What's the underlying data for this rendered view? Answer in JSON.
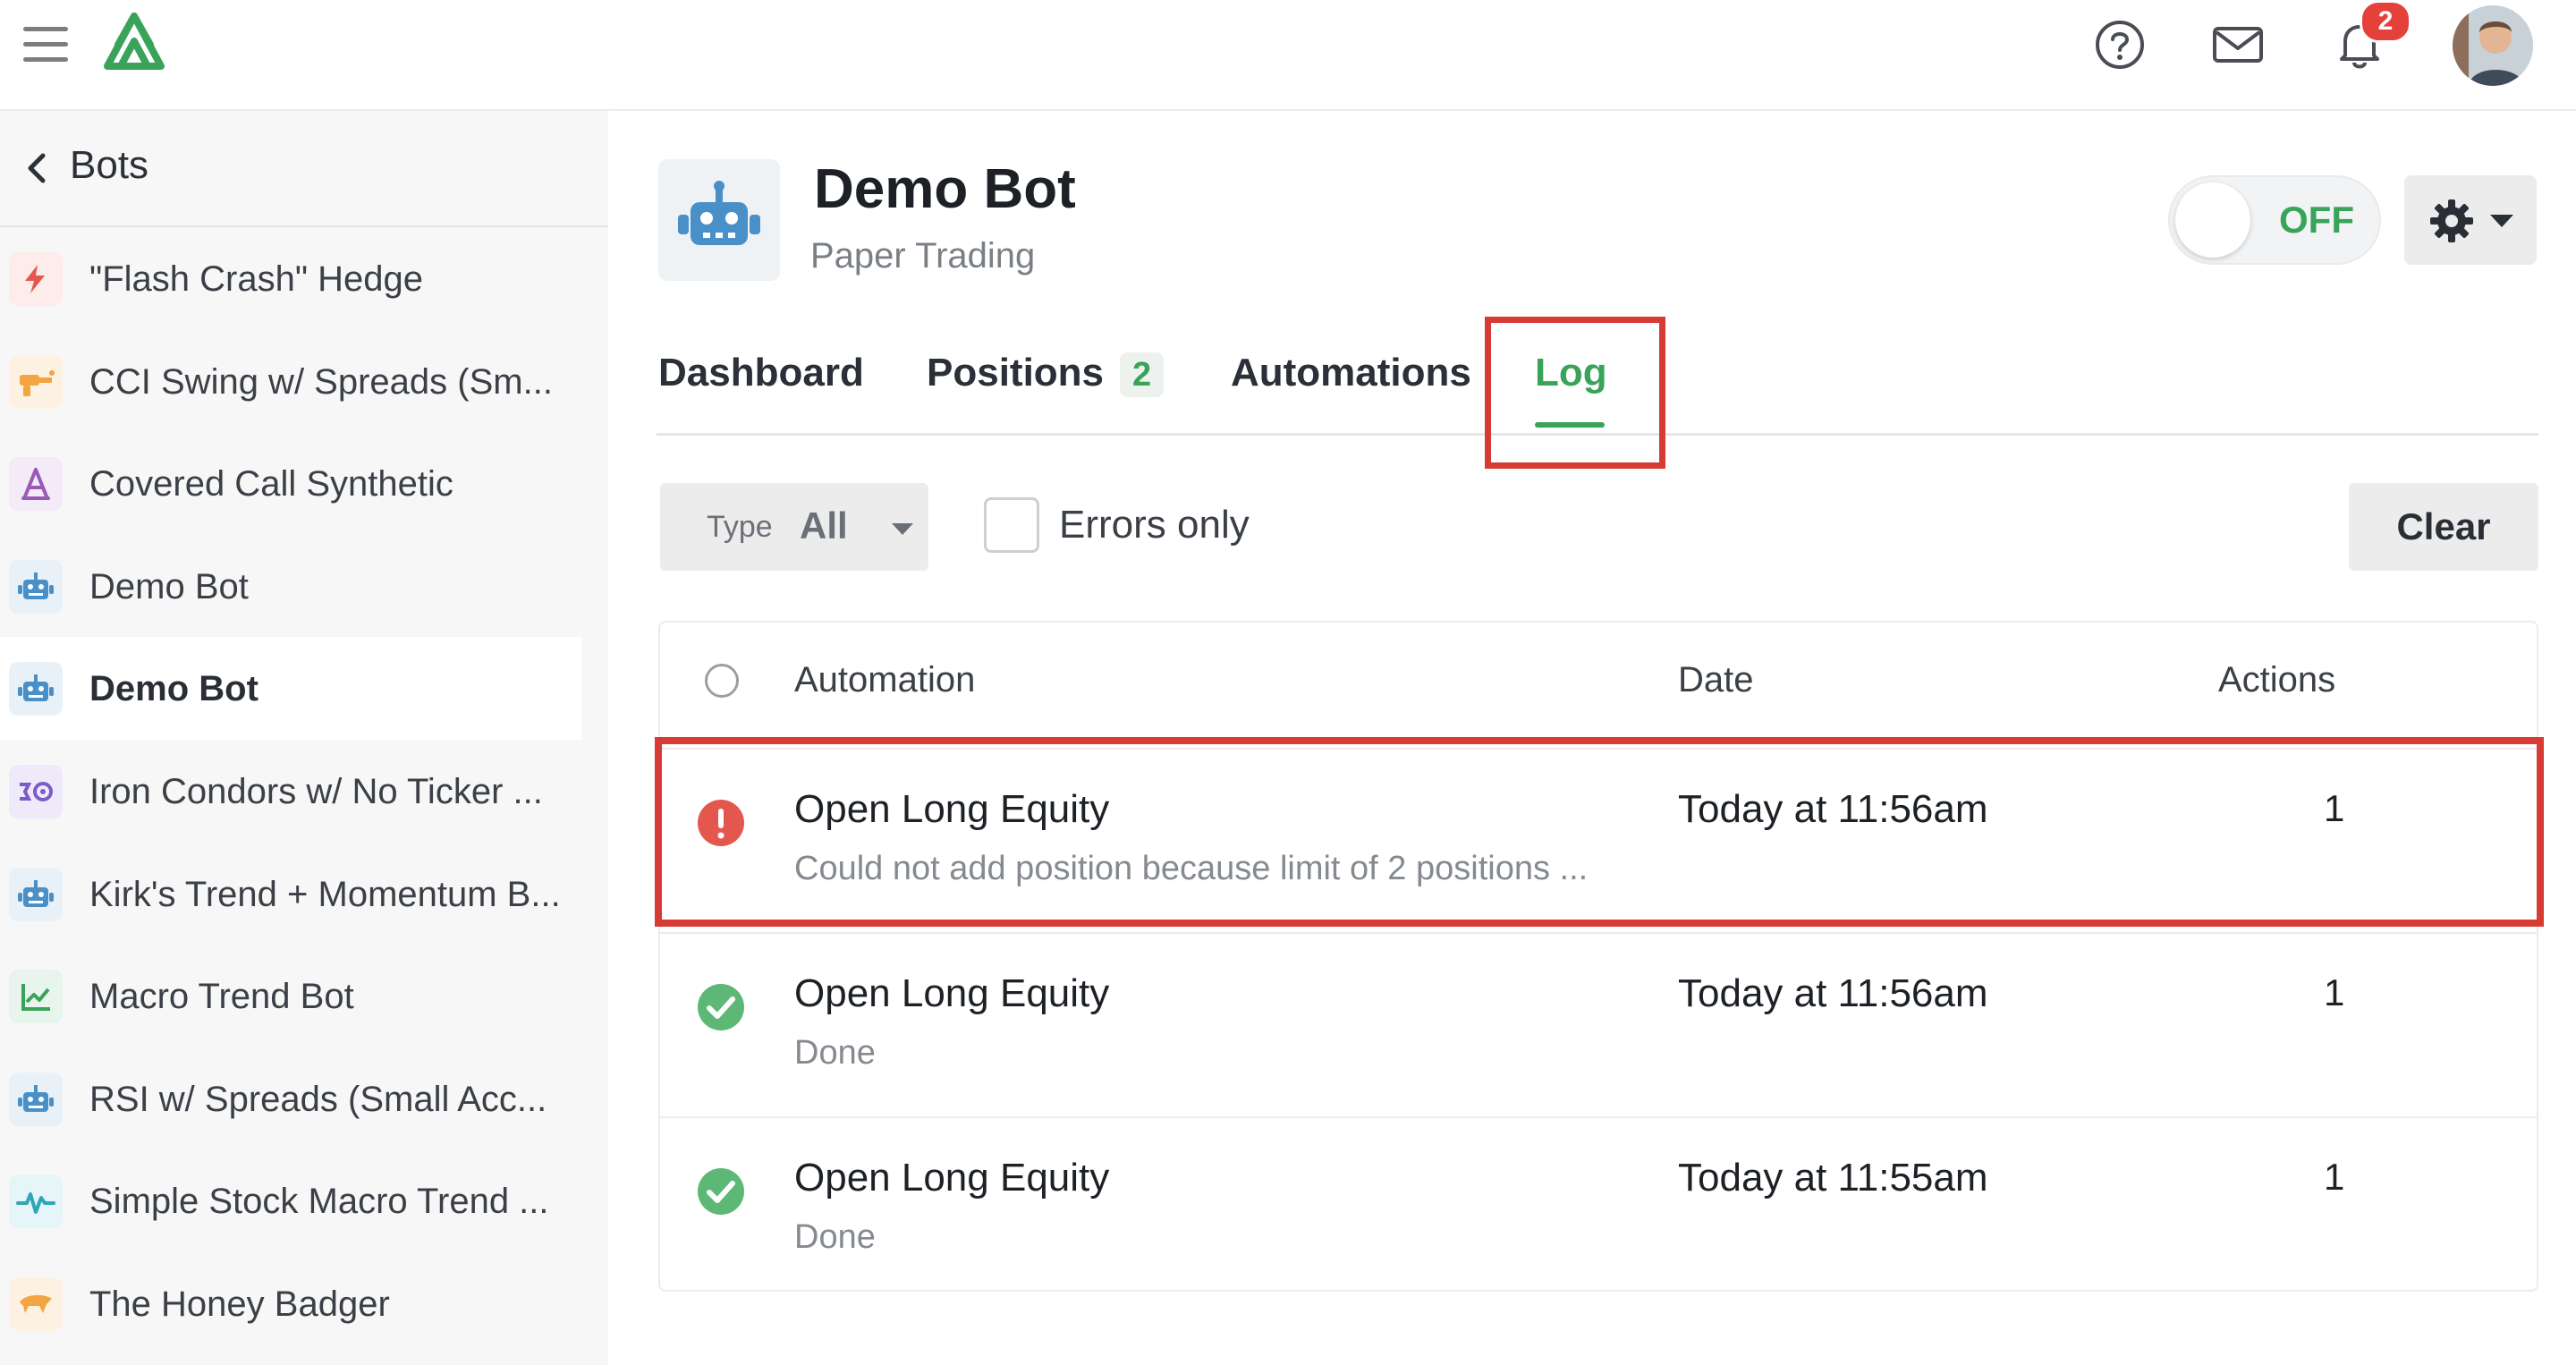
{
  "topbar": {
    "icons": [
      "menu-icon",
      "logo-icon",
      "help-icon",
      "mail-icon",
      "bell-icon"
    ],
    "notification_count": "2"
  },
  "sidebar": {
    "back_label": "Bots",
    "items": [
      {
        "label": "\"Flash Crash\" Hedge",
        "icon": "lightning-icon",
        "color": "#e4574f"
      },
      {
        "label": "CCI Swing w/ Spreads (Sm...",
        "icon": "raygun-icon",
        "color": "#f2a541"
      },
      {
        "label": "Covered Call Synthetic",
        "icon": "compass-icon",
        "color": "#9b59b6"
      },
      {
        "label": "Demo Bot",
        "icon": "robot-icon",
        "color": "#4a90c8"
      },
      {
        "label": "Demo Bot",
        "icon": "robot-icon",
        "color": "#4a90c8",
        "active": true
      },
      {
        "label": "Iron Condors w/ No Ticker ...",
        "icon": "condor-icon",
        "color": "#7b5cc7"
      },
      {
        "label": "Kirk's Trend + Momentum B...",
        "icon": "robot-icon",
        "color": "#4a90c8"
      },
      {
        "label": "Macro Trend Bot",
        "icon": "chart-icon",
        "color": "#3aa35a"
      },
      {
        "label": "RSI w/ Spreads (Small Acc...",
        "icon": "robot-icon",
        "color": "#4a90c8"
      },
      {
        "label": "Simple Stock Macro Trend ...",
        "icon": "pulse-icon",
        "color": "#2fa7b8"
      },
      {
        "label": "The Honey Badger",
        "icon": "badger-icon",
        "color": "#f2a541"
      }
    ]
  },
  "header": {
    "title": "Demo Bot",
    "subtitle": "Paper Trading",
    "toggle_label": "OFF"
  },
  "tabs": {
    "dashboard": "Dashboard",
    "positions": "Positions",
    "positions_count": "2",
    "automations": "Automations",
    "log": "Log",
    "active": "log"
  },
  "filters": {
    "type_label": "Type",
    "type_value": "All",
    "errors_only_label": "Errors only",
    "errors_only_checked": false,
    "clear_label": "Clear"
  },
  "table": {
    "columns": {
      "automation": "Automation",
      "date": "Date",
      "actions": "Actions"
    },
    "rows": [
      {
        "status": "error",
        "title": "Open Long Equity",
        "message": "Could not add position because limit of 2 positions ...",
        "date": "Today at 11:56am",
        "actions": "1"
      },
      {
        "status": "success",
        "title": "Open Long Equity",
        "message": "Done",
        "date": "Today at 11:56am",
        "actions": "1"
      },
      {
        "status": "success",
        "title": "Open Long Equity",
        "message": "Done",
        "date": "Today at 11:55am",
        "actions": "1"
      }
    ]
  },
  "colors": {
    "brand_green": "#3aa35a",
    "error_red": "#e4574f",
    "highlight_red": "#d63b34"
  }
}
